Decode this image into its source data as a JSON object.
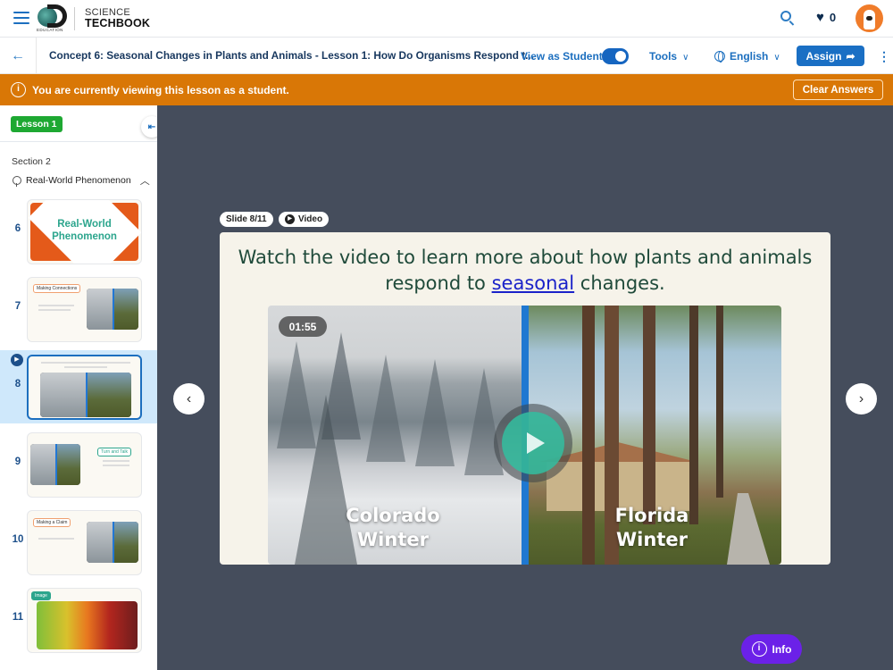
{
  "header": {
    "brand_edu": "EDUCATION",
    "brand_line1": "SCIENCE",
    "brand_line2": "TECHBOOK",
    "favorites_count": "0",
    "icons": {
      "menu": "hamburger-icon",
      "search": "search-icon",
      "favorites": "heart-icon",
      "avatar": "dog-mascot-avatar"
    }
  },
  "navbar": {
    "back_icon": "←",
    "title": "Concept 6: Seasonal Changes in Plants and Animals - Lesson 1: How Do Organisms Respond t...",
    "view_as_student_label": "View as Student",
    "view_as_student_on": true,
    "tools_label": "Tools",
    "language_label": "English",
    "assign_label": "Assign",
    "chevron": "⌄",
    "more_icon": "⋮",
    "share_icon": "➦"
  },
  "banner": {
    "icon": "i",
    "message": "You are currently viewing this lesson as a student.",
    "clear_answers_label": "Clear Answers",
    "color": "#d97706"
  },
  "sidebar": {
    "lesson_badge": "Lesson 1",
    "collapse_icon": "⇤",
    "section_label": "Section 2",
    "section_name": "Real-World Phenomenon",
    "section_expanded_icon": "^",
    "slides": [
      {
        "number": "6",
        "title_line1": "Real-World",
        "title_line2": "Phenomenon",
        "active": false
      },
      {
        "number": "7",
        "tag": "Making Connections",
        "active": false
      },
      {
        "number": "8",
        "active": true,
        "type": "video"
      },
      {
        "number": "9",
        "tag": "Turn and Talk",
        "active": false
      },
      {
        "number": "10",
        "tag": "Making a Claim",
        "active": false
      },
      {
        "number": "11",
        "tag": "Image",
        "active": false
      }
    ]
  },
  "slide": {
    "position_label": "Slide 8/11",
    "type_label": "Video",
    "title_before": "Watch the video to learn more about how plants and animals respond to ",
    "title_link": "seasonal",
    "title_after": " changes.",
    "video": {
      "duration": "01:55",
      "left_label_1": "Colorado",
      "left_label_2": "Winter",
      "right_label_1": "Florida",
      "right_label_2": "Winter"
    },
    "prev_icon": "‹",
    "next_icon": "›"
  },
  "info_button": {
    "label": "Info",
    "icon": "i",
    "color": "#6b21e8"
  }
}
